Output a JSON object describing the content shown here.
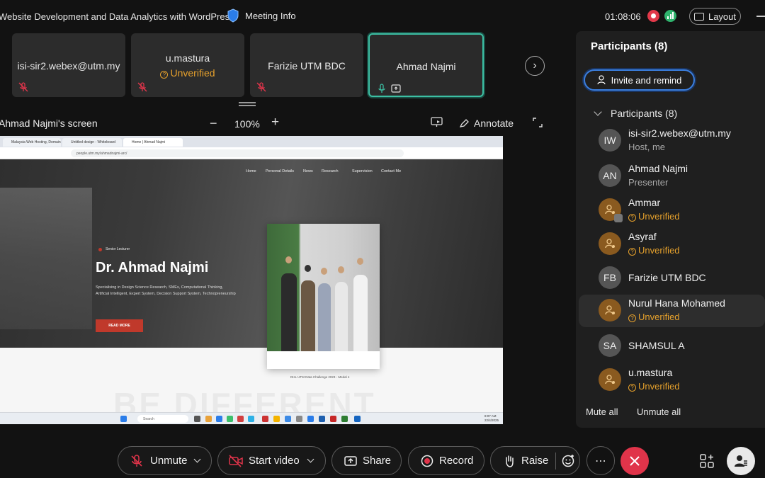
{
  "topbar": {
    "meeting_title": "Website Development and Data Analytics with WordPress",
    "meeting_info": "Meeting Info",
    "timer": "01:08:06",
    "layout_label": "Layout"
  },
  "tiles": [
    {
      "name": "isi-sir2.webex@utm.my",
      "unverified": ""
    },
    {
      "name": "u.mastura",
      "unverified": "Unverified"
    },
    {
      "name": "Farizie UTM BDC",
      "unverified": ""
    },
    {
      "name": "Ahmad Najmi",
      "unverified": ""
    }
  ],
  "share": {
    "screen_name": "Ahmad Najmi's screen",
    "zoom": "100%",
    "annotate": "Annotate"
  },
  "shared_screen": {
    "tabs": [
      "Malaysia Web Hosting, Domain",
      "Untitled design - Whiteboard",
      "Home | Ahmad Najmi"
    ],
    "url": "people.utm.my/ahmadnajmi-arc/",
    "nav": [
      "Home",
      "Personal Details",
      "News",
      "Research",
      "Supervision",
      "Contact Me"
    ],
    "tag": "Senior Lecturer",
    "hero_name": "Dr. Ahmad Najmi",
    "hero_desc": "Specialising in Design Science Research, SMEs, Computational Thinking, Artificial Intelligent, Expert System, Decision Support System, Technopreneurship",
    "read_more": "READ MORE",
    "caption": "DHL UTM Data Challenge 2023 - Medal 4",
    "watermark": "BE DIFFERENT",
    "taskbar_search": "Search",
    "taskbar_time": "8:07 AM",
    "taskbar_date": "22/4/2025"
  },
  "participants": {
    "title": "Participants (8)",
    "invite_label": "Invite and remind",
    "section_label": "Participants (8)",
    "list": [
      {
        "initials": "IW",
        "name": "isi-sir2.webex@utm.my",
        "sub": "Host, me",
        "type": "init"
      },
      {
        "initials": "AN",
        "name": "Ahmad Najmi",
        "sub": "Presenter",
        "type": "init"
      },
      {
        "initials": "",
        "name": "Ammar",
        "sub": "Unverified",
        "type": "guest"
      },
      {
        "initials": "",
        "name": "Asyraf",
        "sub": "Unverified",
        "type": "guest"
      },
      {
        "initials": "FB",
        "name": "Farizie UTM BDC",
        "sub": "",
        "type": "init"
      },
      {
        "initials": "",
        "name": "Nurul Hana Mohamed",
        "sub": "Unverified",
        "type": "guest"
      },
      {
        "initials": "SA",
        "name": "SHAMSUL A",
        "sub": "",
        "type": "init"
      },
      {
        "initials": "",
        "name": "u.mastura",
        "sub": "Unverified",
        "type": "guest"
      }
    ],
    "mute_all": "Mute all",
    "unmute_all": "Unmute all"
  },
  "controls": {
    "unmute": "Unmute",
    "start_video": "Start video",
    "share": "Share",
    "record": "Record",
    "raise": "Raise",
    "more": "⋯"
  },
  "colors": {
    "accent_blue": "#3b7fe0",
    "active_tile": "#3cbfa3",
    "end_call": "#e0344a",
    "unverified": "#e6a12c"
  }
}
